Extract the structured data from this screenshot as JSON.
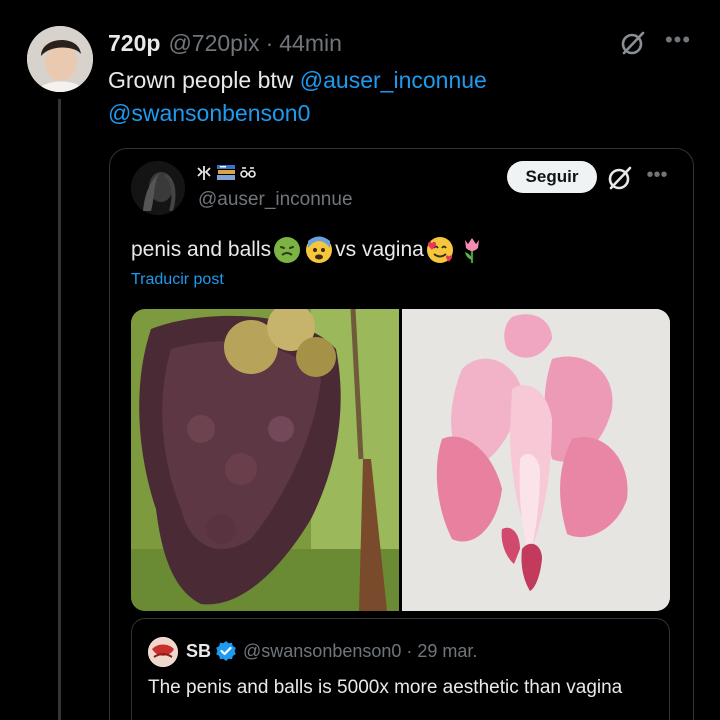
{
  "tweet": {
    "author_name": "720p",
    "author_handle": "@720pix",
    "separator": "·",
    "time": "44min",
    "text": "Grown people btw",
    "mentions": [
      "@auser_inconnue",
      "@swansonbenson0"
    ]
  },
  "quote": {
    "handle": "@auser_inconnue",
    "follow_label": "Seguir",
    "text_before": "penis and balls",
    "text_middle": " vs vagina ",
    "translate_label": "Traducir post",
    "emojis": [
      "nauseated-face",
      "anxious-face",
      "smiling-face-with-hearts",
      "tulip"
    ],
    "name_badges": [
      "zh-glyph-icon",
      "books-icon",
      "glasses-icon"
    ]
  },
  "nested_quote": {
    "name": "SB",
    "handle": "@swansonbenson0",
    "separator": "·",
    "time": "29 mar.",
    "text": "The penis and balls is 5000x more aesthetic than vagina"
  },
  "colors": {
    "background": "#000000",
    "text_primary": "#e7e9ea",
    "text_secondary": "#71767b",
    "accent": "#1d9bf0",
    "border": "#2f3336"
  }
}
